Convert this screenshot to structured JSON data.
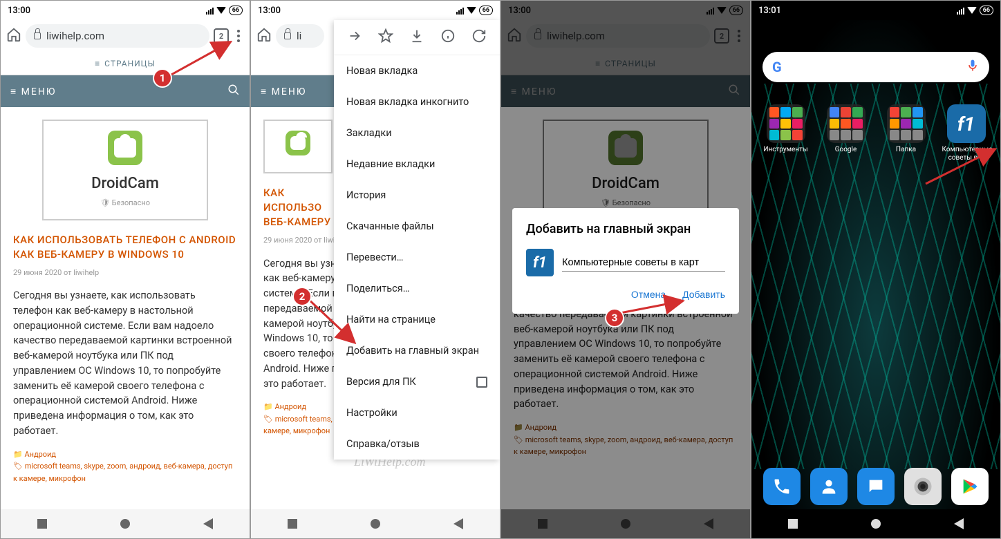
{
  "status": {
    "time1": "13:00",
    "time4": "13:01",
    "battery": "66"
  },
  "chrome": {
    "url": "liwihelp.com",
    "tabs": "2"
  },
  "site": {
    "pages": "СТРАНИЦЫ",
    "menu": "МЕНЮ",
    "app": "DroidCam",
    "safe": "Безопасно",
    "title": "КАК ИСПОЛЬЗОВАТЬ ТЕЛЕФОН С ANDROID КАК ВЕБ-КАМЕРУ В WINDOWS 10",
    "title_cut": "КАК ИСПОЛЬЗО\nВЕБ-КАМЕРУ В",
    "meta": "29 июня 2020 от liwihelp",
    "meta_cut": "29 июня 2020 от liwi",
    "body": "Сегодня вы узнаете, как использовать телефон как веб-камеру в настольной операционной системе. Если вам надоело качество передаваемой картинки встроенной веб-камерой ноутбука или ПК под управлением ОС Windows 10, то попробуйте заменить её камерой своего телефона с операционной системой Android. Ниже приведена информация о том, как это работает.",
    "cat": "Андроид",
    "tags": "microsoft teams, skype, zoom, андроид, веб-камера, доступ к камере, микрофон"
  },
  "menu": {
    "i1": "Новая вкладка",
    "i2": "Новая вкладка инкогнито",
    "i3": "Закладки",
    "i4": "Недавние вкладки",
    "i5": "История",
    "i6": "Скачанные файлы",
    "i7": "Перевести…",
    "i8": "Поделиться…",
    "i9": "Найти на странице",
    "i10": "Добавить на главный экран",
    "i11": "Версия для ПК",
    "i12": "Настройки",
    "i13": "Справка/отзыв"
  },
  "dialog": {
    "title": "Добавить на главный экран",
    "input": "Компьютерные советы в карт",
    "cancel": "Отмена",
    "add": "Добавить"
  },
  "home": {
    "a1": "Инструменты",
    "a2": "Google",
    "a3": "Папка",
    "a4": "Компьютерные советы в …"
  },
  "badges": {
    "b1": "1",
    "b2": "2",
    "b3": "3"
  },
  "watermark": "LiWiHelp.com"
}
